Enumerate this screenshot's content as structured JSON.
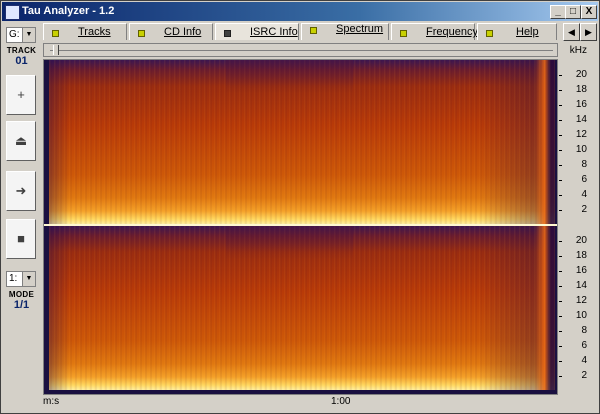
{
  "window": {
    "title": "Tau Analyzer - 1.2",
    "min": "_",
    "max": "□",
    "close": "X"
  },
  "tabs": [
    {
      "label": "Tracks",
      "active": false
    },
    {
      "label": "CD Info",
      "active": false
    },
    {
      "label": "ISRC Info",
      "active": true
    },
    {
      "label": "Spectrum",
      "active": false
    },
    {
      "label": "Frequency",
      "active": false
    },
    {
      "label": "Help",
      "active": false
    }
  ],
  "nav": {
    "left": "◀",
    "right": "▶"
  },
  "left_panel": {
    "drive_combo": "G:",
    "track_label": "TRACK",
    "track_value": "01",
    "mode_combo": "1:",
    "mode_label": "MODE",
    "mode_value": "1/1",
    "btn_add": "+",
    "btn_eject": "⏏",
    "btn_play": "➜",
    "btn_stop": "■"
  },
  "freq_axis": {
    "unit": "kHz",
    "ticks": [
      "20",
      "18",
      "16",
      "14",
      "12",
      "10",
      "8",
      "6",
      "4",
      "2"
    ]
  },
  "time_axis": {
    "unit": "m:s",
    "marks": [
      "1:00"
    ]
  }
}
